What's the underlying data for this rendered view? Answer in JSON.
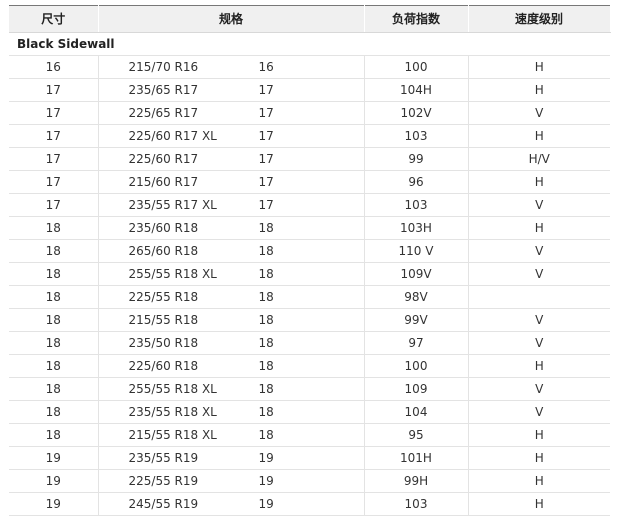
{
  "headers": {
    "size": "尺寸",
    "spec": "规格",
    "load": "负荷指数",
    "speed": "速度级别"
  },
  "section_title": "Black Sidewall",
  "rows": [
    {
      "size": "16",
      "spec": "215/70 R16",
      "rim": "16",
      "load": "100",
      "speed": "H"
    },
    {
      "size": "17",
      "spec": "235/65 R17",
      "rim": "17",
      "load": "104H",
      "speed": "H"
    },
    {
      "size": "17",
      "spec": "225/65 R17",
      "rim": "17",
      "load": "102V",
      "speed": "V"
    },
    {
      "size": "17",
      "spec": "225/60 R17 XL",
      "rim": "17",
      "load": "103",
      "speed": "H"
    },
    {
      "size": "17",
      "spec": "225/60 R17",
      "rim": "17",
      "load": "99",
      "speed": "H/V"
    },
    {
      "size": "17",
      "spec": "215/60 R17",
      "rim": "17",
      "load": "96",
      "speed": "H"
    },
    {
      "size": "17",
      "spec": "235/55 R17 XL",
      "rim": "17",
      "load": "103",
      "speed": "V"
    },
    {
      "size": "18",
      "spec": "235/60 R18",
      "rim": "18",
      "load": "103H",
      "speed": "H"
    },
    {
      "size": "18",
      "spec": "265/60 R18",
      "rim": "18",
      "load": "110 V",
      "speed": "V"
    },
    {
      "size": "18",
      "spec": "255/55 R18 XL",
      "rim": "18",
      "load": "109V",
      "speed": "V"
    },
    {
      "size": "18",
      "spec": "225/55 R18",
      "rim": "18",
      "load": "98V",
      "speed": ""
    },
    {
      "size": "18",
      "spec": "215/55 R18",
      "rim": "18",
      "load": "99V",
      "speed": "V"
    },
    {
      "size": "18",
      "spec": "235/50 R18",
      "rim": "18",
      "load": "97",
      "speed": "V"
    },
    {
      "size": "18",
      "spec": "225/60 R18",
      "rim": "18",
      "load": "100",
      "speed": "H"
    },
    {
      "size": "18",
      "spec": "255/55 R18 XL",
      "rim": "18",
      "load": "109",
      "speed": "V"
    },
    {
      "size": "18",
      "spec": "235/55 R18 XL",
      "rim": "18",
      "load": "104",
      "speed": "V"
    },
    {
      "size": "18",
      "spec": "215/55 R18 XL",
      "rim": "18",
      "load": "95",
      "speed": "H"
    },
    {
      "size": "19",
      "spec": "235/55 R19",
      "rim": "19",
      "load": "101H",
      "speed": "H"
    },
    {
      "size": "19",
      "spec": "225/55 R19",
      "rim": "19",
      "load": "99H",
      "speed": "H"
    },
    {
      "size": "19",
      "spec": "245/55 R19",
      "rim": "19",
      "load": "103",
      "speed": "H"
    }
  ]
}
